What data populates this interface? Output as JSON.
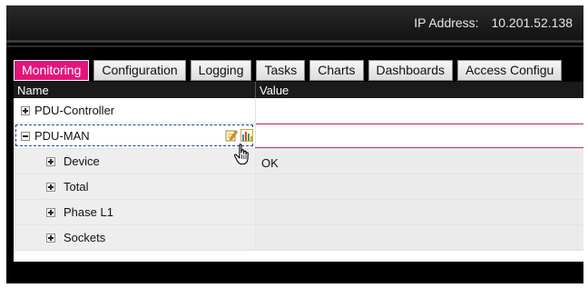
{
  "header": {
    "ip_label": "IP Address:",
    "ip_value": "10.201.52.138"
  },
  "tabs": [
    {
      "label": "Monitoring",
      "active": true
    },
    {
      "label": "Configuration",
      "active": false
    },
    {
      "label": "Logging",
      "active": false
    },
    {
      "label": "Tasks",
      "active": false
    },
    {
      "label": "Charts",
      "active": false
    },
    {
      "label": "Dashboards",
      "active": false
    },
    {
      "label": "Access Configu",
      "active": false
    }
  ],
  "table": {
    "columns": {
      "name": "Name",
      "value": "Value"
    },
    "rows": [
      {
        "label": "PDU-Controller",
        "value": "",
        "expander": "plus"
      },
      {
        "label": "PDU-MAN",
        "value": "",
        "expander": "minus",
        "selected": true
      },
      {
        "label": "Device",
        "value": "OK",
        "expander": "plus"
      },
      {
        "label": "Total",
        "value": "",
        "expander": "plus"
      },
      {
        "label": "Phase L1",
        "value": "",
        "expander": "plus"
      },
      {
        "label": "Sockets",
        "value": "",
        "expander": "plus"
      }
    ]
  },
  "colors": {
    "active_tab": "#e2157a",
    "selection_line": "#cc2a72",
    "selection_border": "#1f3f9a"
  },
  "icons": {
    "row_actions": [
      "edit-icon",
      "chart-icon"
    ],
    "pointer": "hand-cursor-icon"
  }
}
